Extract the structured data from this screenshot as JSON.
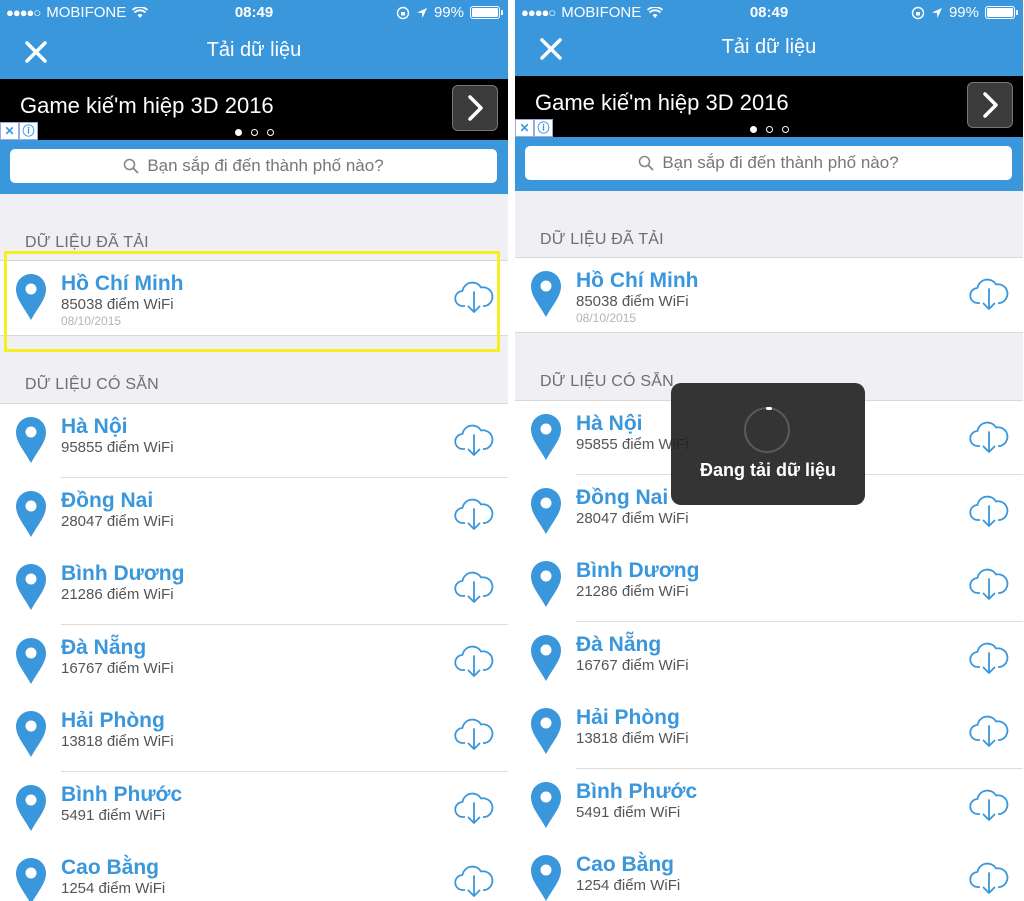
{
  "status": {
    "carrier": "MOBIFONE",
    "signal_dots": "●●●●○",
    "time": "08:49",
    "battery": "99%"
  },
  "nav": {
    "title": "Tải dữ liệu"
  },
  "ad": {
    "text": "Game kiế'm hiệp 3D 2016",
    "info_icon": "ⓘ"
  },
  "search": {
    "placeholder": "Bạn sắp đi đến thành phố nào?"
  },
  "sections": {
    "downloaded": "DỮ LIỆU ĐÃ TẢI",
    "available": "DỮ LIỆU CÓ SẴN"
  },
  "downloaded": {
    "name": "Hồ Chí Minh",
    "count": "85038  điểm WiFi",
    "date": "08/10/2015"
  },
  "cities": [
    {
      "name": "Hà Nội",
      "count": "95855  điểm WiFi"
    },
    {
      "name": "Đồng Nai",
      "count": "28047  điểm WiFi"
    },
    {
      "name": "Bình Dương",
      "count": "21286  điểm WiFi"
    },
    {
      "name": "Đà Nẵng",
      "count": "16767  điểm WiFi"
    },
    {
      "name": "Hải Phòng",
      "count": "13818  điểm WiFi"
    },
    {
      "name": "Bình Phước",
      "count": "5491  điểm WiFi"
    },
    {
      "name": "Cao Bằng",
      "count": "1254  điểm WiFi"
    }
  ],
  "hud": {
    "text": "Đang tải dữ liệu"
  },
  "colors": {
    "accent": "#3a97dc",
    "highlight": "#f5ef22"
  },
  "icons": [
    "close-icon",
    "search-icon",
    "map-pin-icon",
    "cloud-download-icon",
    "chevron-right-icon",
    "wifi-icon",
    "location-arrow-icon",
    "lock-rotation-icon"
  ]
}
